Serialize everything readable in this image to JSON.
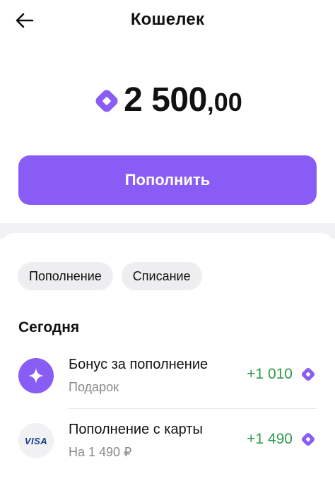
{
  "header": {
    "title": "Кошелек",
    "back_icon": "arrow-left-icon"
  },
  "balance": {
    "integer": "2 500",
    "fraction": ",00",
    "icon": "diamond-coin-icon"
  },
  "actions": {
    "topup_label": "Пополнить"
  },
  "filters": [
    {
      "label": "Пополнение"
    },
    {
      "label": "Списание"
    }
  ],
  "history": {
    "section_title": "Сегодня",
    "transactions": [
      {
        "title": "Бонус за пополнение",
        "subtitle": "Подарок",
        "amount": "+1 010",
        "icon": "sparkle-icon"
      },
      {
        "title": "Пополнение с карты",
        "subtitle": "На 1 490 ₽",
        "amount": "+1 490",
        "icon": "visa-card-icon",
        "icon_text": "VISA"
      }
    ]
  },
  "colors": {
    "accent": "#8a5cf6",
    "positive": "#2e9a4a",
    "chip_bg": "#eeeef0",
    "muted_text": "#8a8a8e"
  }
}
